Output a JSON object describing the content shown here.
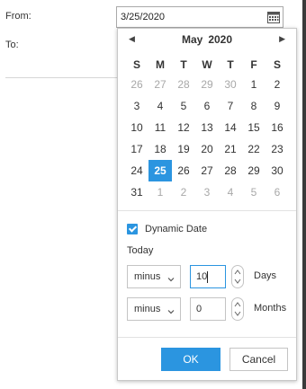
{
  "form": {
    "from_label": "From:",
    "to_label": "To:",
    "from_value": "3/25/2020"
  },
  "calendar": {
    "month": "May",
    "year": "2020",
    "weekdays": [
      "S",
      "M",
      "T",
      "W",
      "T",
      "F",
      "S"
    ],
    "weeks": [
      [
        "26",
        "27",
        "28",
        "29",
        "30",
        "1",
        "2"
      ],
      [
        "3",
        "4",
        "5",
        "6",
        "7",
        "8",
        "9"
      ],
      [
        "10",
        "11",
        "12",
        "13",
        "14",
        "15",
        "16"
      ],
      [
        "17",
        "18",
        "19",
        "20",
        "21",
        "22",
        "23"
      ],
      [
        "24",
        "25",
        "26",
        "27",
        "28",
        "29",
        "30"
      ],
      [
        "31",
        "1",
        "2",
        "3",
        "4",
        "5",
        "6"
      ]
    ],
    "selected_day": "25",
    "accent_color": "#2b95e0"
  },
  "dynamic": {
    "checkbox_label": "Dynamic Date",
    "checked": true,
    "today_label": "Today",
    "rows": [
      {
        "operator": "minus",
        "value": "10",
        "unit": "Days"
      },
      {
        "operator": "minus",
        "value": "0",
        "unit": "Months"
      }
    ]
  },
  "buttons": {
    "ok": "OK",
    "cancel": "Cancel"
  }
}
